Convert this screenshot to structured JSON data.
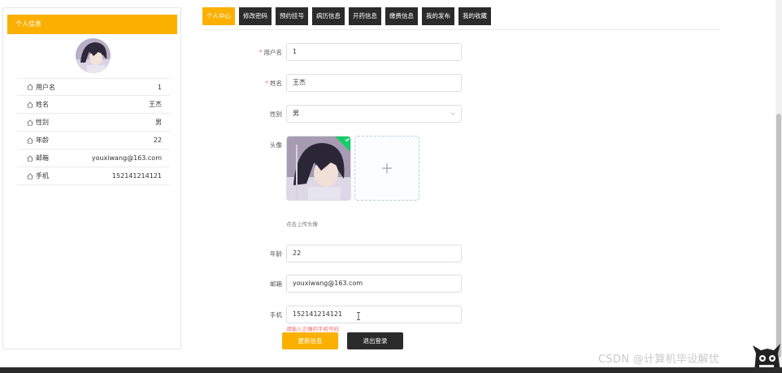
{
  "left_panel": {
    "header": "个人信息",
    "rows": [
      {
        "label": "用户名",
        "value": "1"
      },
      {
        "label": "姓名",
        "value": "王杰"
      },
      {
        "label": "性别",
        "value": "男"
      },
      {
        "label": "年龄",
        "value": "22"
      },
      {
        "label": "邮箱",
        "value": "youxiwang@163.com"
      },
      {
        "label": "手机",
        "value": "152141214121"
      }
    ]
  },
  "tabs": [
    {
      "label": "个人中心",
      "active": true
    },
    {
      "label": "修改密码",
      "active": false
    },
    {
      "label": "预约挂号",
      "active": false
    },
    {
      "label": "病历信息",
      "active": false
    },
    {
      "label": "开药信息",
      "active": false
    },
    {
      "label": "缴费信息",
      "active": false
    },
    {
      "label": "我的发布",
      "active": false
    },
    {
      "label": "我的收藏",
      "active": false
    }
  ],
  "form": {
    "username": {
      "label": "用户名",
      "required": "*",
      "value": "1"
    },
    "name": {
      "label": "姓名",
      "required": "*",
      "value": "王杰"
    },
    "gender": {
      "label": "性别",
      "value": "男"
    },
    "avatar": {
      "label": "头像",
      "tip": "点击上传头像"
    },
    "age": {
      "label": "年龄",
      "value": "22"
    },
    "email": {
      "label": "邮箱",
      "value": "youxiwang@163.com"
    },
    "phone": {
      "label": "手机",
      "value": "152141214121",
      "error": "请输入正确的手机号码"
    }
  },
  "buttons": {
    "update": "更新信息",
    "logout": "退出登录"
  },
  "watermark": "CSDN @计算机毕设解忧",
  "colors": {
    "accent": "#fbb000",
    "dark": "#2b2b2b",
    "error": "#f56c6c",
    "success": "#13ce66"
  }
}
